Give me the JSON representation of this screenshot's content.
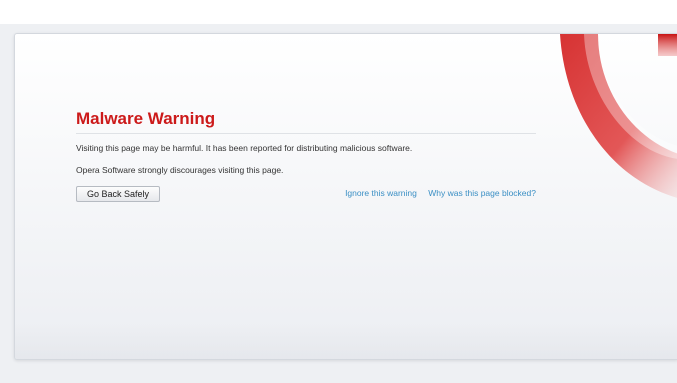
{
  "page": {
    "title": "Malware Warning",
    "message_1": "Visiting this page may be harmful. It has been reported for distributing malicious software.",
    "message_2": "Opera Software strongly discourages visiting this page."
  },
  "actions": {
    "back_label": "Go Back Safely",
    "ignore_label": "Ignore this warning",
    "why_label": "Why was this page blocked?"
  },
  "logo": {
    "icon": "opera-logo-icon",
    "color": "#cc1a1a"
  },
  "colors": {
    "title": "#cc1a1a",
    "link": "#3b8fc4"
  }
}
